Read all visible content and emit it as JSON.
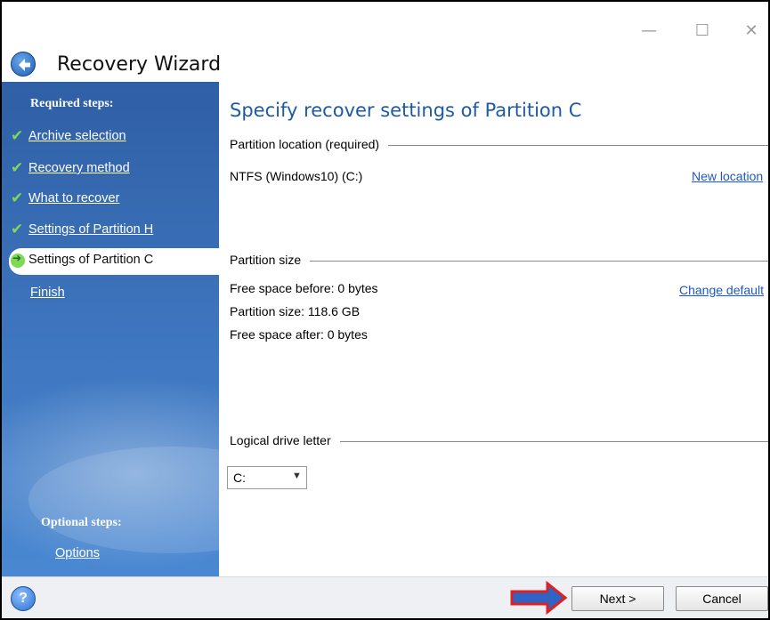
{
  "window": {
    "title": "Recovery Wizard",
    "controls": {
      "minimize": "—",
      "maximize": "☐",
      "close": "✕"
    }
  },
  "sidebar": {
    "required_heading": "Required steps:",
    "items": [
      {
        "label": "Archive selection",
        "state": "done"
      },
      {
        "label": "Recovery method",
        "state": "done"
      },
      {
        "label": "What to recover",
        "state": "done"
      },
      {
        "label": "Settings of Partition H",
        "state": "done"
      },
      {
        "label": "Settings of Partition C",
        "state": "current"
      },
      {
        "label": "Finish",
        "state": "pending"
      }
    ],
    "optional_heading": "Optional steps:",
    "optional_items": [
      {
        "label": "Options"
      }
    ]
  },
  "main": {
    "title": "Specify recover settings of Partition C",
    "location": {
      "section_label": "Partition location (required)",
      "value": "NTFS (Windows10) (C:)",
      "link": "New location"
    },
    "size": {
      "section_label": "Partition size",
      "free_before": "Free space before: 0 bytes",
      "partition_size": "Partition size: 118.6 GB",
      "free_after": "Free space after: 0 bytes",
      "link": "Change default"
    },
    "drive_letter": {
      "section_label": "Logical drive letter",
      "selected": "C:"
    }
  },
  "footer": {
    "help": "?",
    "next_label": "Next >",
    "cancel_label": "Cancel"
  },
  "colors": {
    "title_blue": "#1f5aa6",
    "link_blue": "#1c58c7",
    "sidebar_blue": "#3f77c0",
    "check_green": "#7ed957",
    "annotation_red": "#e02020"
  }
}
